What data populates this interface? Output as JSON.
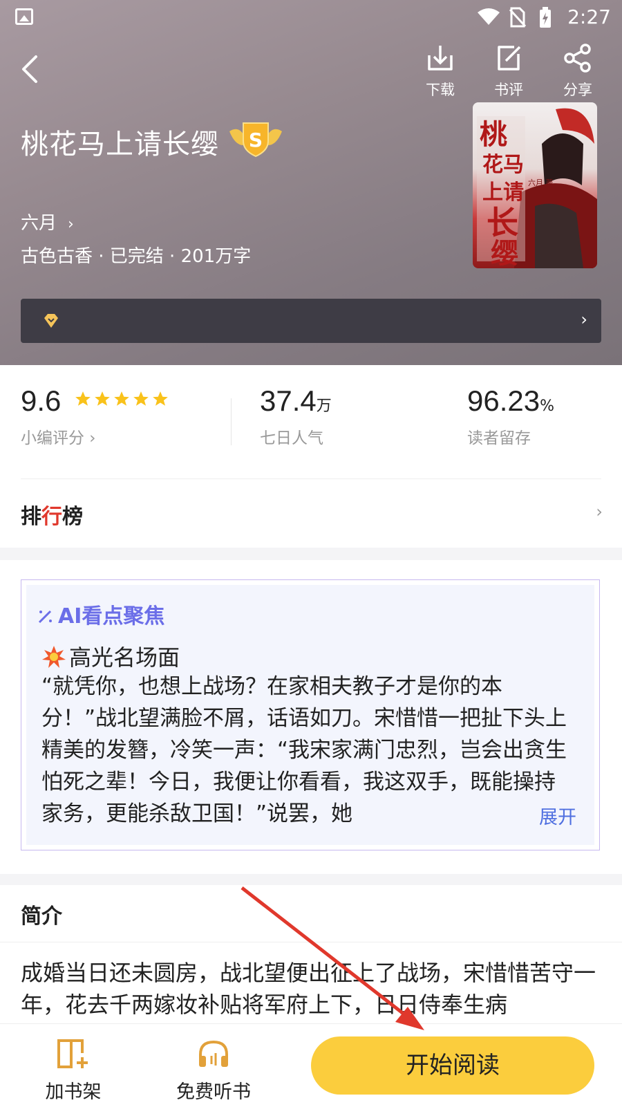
{
  "status_bar": {
    "time": "2:27"
  },
  "header": {
    "download_label": "下载",
    "review_label": "书评",
    "share_label": "分享"
  },
  "book": {
    "title": "桃花马上请长缨",
    "badge_letter": "S",
    "author": "六月",
    "meta": "古色古香 · 已完结 · 201万字",
    "cover_title": "桃花马上请长缨",
    "cover_author": "六月 著"
  },
  "stats": {
    "score": "9.6",
    "score_label": "小编评分 ›",
    "rating_stars": 5,
    "popularity": "37.4",
    "popularity_unit": "万",
    "popularity_label": "七日人气",
    "retention": "96.23",
    "retention_unit": "%",
    "retention_label": "读者留存"
  },
  "ranking": {
    "label_prefix": "排",
    "label_one": "行",
    "label_suffix": "榜"
  },
  "ai_focus": {
    "title": "AI看点聚焦",
    "highlight_title": "高光名场面",
    "text": "“就凭你，也想上战场？在家相夫教子才是你的本分！”战北望满脸不屑，话语如刀。宋惜惜一把扯下头上精美的发簪，冷笑一声：“我宋家满门忠烈，岂会出贪生怕死之辈！今日，我便让你看看，我这双手，既能操持家务，更能杀敌卫国！”说罢，她",
    "expand_label": "展开"
  },
  "intro": {
    "title": "简介",
    "text": "成婚当日还未圆房，战北望便出征上了战场，宋惜惜苦守一年，花去千两嫁妆补贴将军府上下，日日侍奉生病"
  },
  "bottom_bar": {
    "add_shelf_label": "加书架",
    "listen_label": "免费听书",
    "read_label": "开始阅读"
  },
  "colors": {
    "accent_yellow": "#fbcd3d",
    "ai_blue": "#6b6ee8",
    "expand_blue": "#4f6fe0",
    "annotation_red": "#e0382c"
  }
}
